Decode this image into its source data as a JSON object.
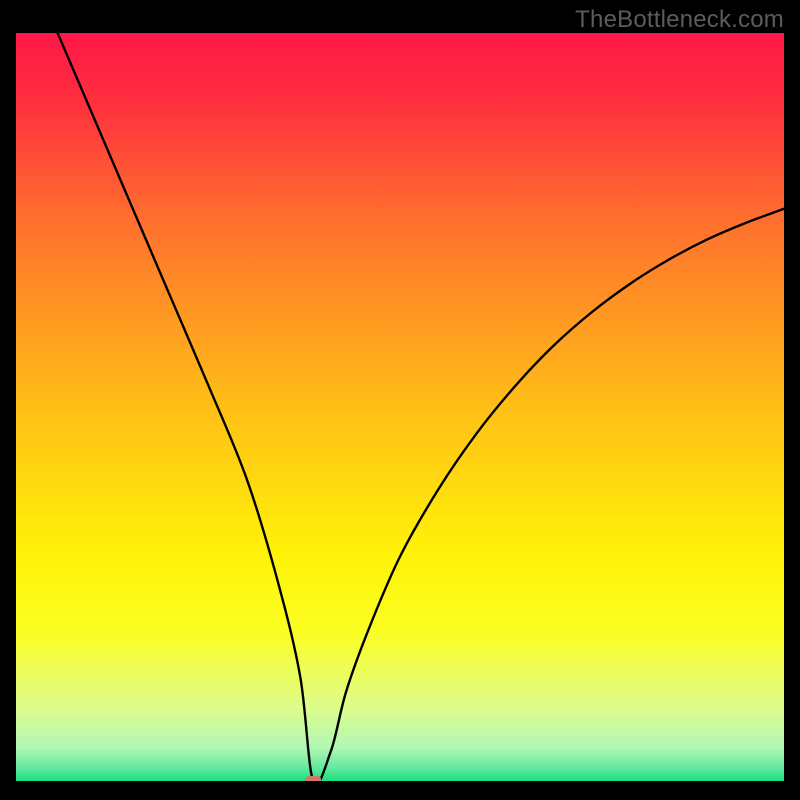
{
  "attribution": "TheBottleneck.com",
  "chart_data": {
    "type": "line",
    "title": "",
    "xlabel": "",
    "ylabel": "",
    "xlim": [
      0,
      100
    ],
    "ylim": [
      0,
      100
    ],
    "gradient_stops": [
      {
        "offset": 0.0,
        "color": "#ff1846"
      },
      {
        "offset": 0.08,
        "color": "#ff2b3f"
      },
      {
        "offset": 0.25,
        "color": "#ff6f2e"
      },
      {
        "offset": 0.5,
        "color": "#ffbf16"
      },
      {
        "offset": 0.7,
        "color": "#fff308"
      },
      {
        "offset": 0.8,
        "color": "#fbfe22"
      },
      {
        "offset": 0.9,
        "color": "#dffc89"
      },
      {
        "offset": 0.955,
        "color": "#b1f7b4"
      },
      {
        "offset": 0.985,
        "color": "#5be89c"
      },
      {
        "offset": 1.0,
        "color": "#14e07e"
      }
    ],
    "series": [
      {
        "name": "bottleneck-curve",
        "x": [
          0,
          5,
          10,
          15,
          20,
          25,
          30,
          34,
          37,
          38.7,
          41,
          43,
          46,
          50,
          55,
          60,
          65,
          70,
          75,
          80,
          85,
          90,
          95,
          100
        ],
        "values": [
          113,
          101,
          89,
          77,
          65,
          53,
          40.5,
          27,
          14,
          0,
          4,
          12,
          20.5,
          30,
          39,
          46.5,
          52.8,
          58.2,
          62.7,
          66.5,
          69.7,
          72.4,
          74.6,
          76.5
        ]
      }
    ],
    "marker": {
      "x": 38.7,
      "y": 0,
      "shape": "rounded-rect",
      "color": "#d6746c"
    }
  }
}
